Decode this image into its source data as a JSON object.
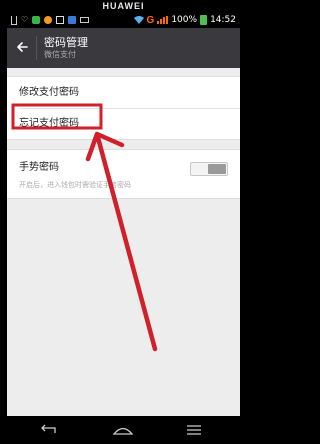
{
  "device": {
    "brand": "HUAWEI"
  },
  "status_bar": {
    "battery_text": "100%",
    "time": "14:52",
    "network_letter": "G"
  },
  "header": {
    "title": "密码管理",
    "subtitle": "微信支付",
    "back_icon": "arrow-left-icon"
  },
  "menu": {
    "items": [
      {
        "label": "修改支付密码"
      },
      {
        "label": "忘记支付密码"
      }
    ]
  },
  "gesture": {
    "label": "手势密码",
    "description": "开启后，进入钱包时需验证手势密码",
    "toggle_state": "off"
  },
  "annotation": {
    "color": "#d0202a"
  },
  "colors": {
    "header_bg": "#3a3a3e",
    "page_bg": "#ededed",
    "network_accent": "#ff6a00",
    "battery": "#4fc04f"
  }
}
